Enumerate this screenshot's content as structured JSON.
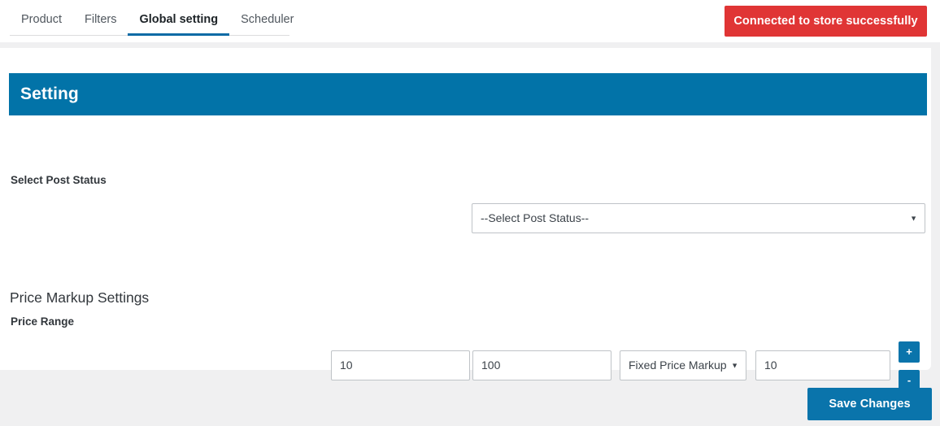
{
  "nav": {
    "tabs": [
      {
        "label": "Product",
        "active": false
      },
      {
        "label": "Filters",
        "active": false
      },
      {
        "label": "Global setting",
        "active": true
      },
      {
        "label": "Scheduler",
        "active": false
      }
    ],
    "status_banner": {
      "text": "Connected to store successfully",
      "color": "#e03535",
      "text_color": "#ffffff"
    }
  },
  "card": {
    "header": {
      "title": "Setting",
      "background": "#0273a8",
      "text_color": "#ffffff"
    },
    "post_status": {
      "label": "Select Post Status",
      "select_value": "--Select Post Status--",
      "caret": "chevron-down-icon"
    },
    "price_markup": {
      "section_heading": "Price Markup Settings",
      "label": "Price Range",
      "min_value": "10",
      "max_value": "100",
      "markup_type": "Fixed Price Markup",
      "markup_amount": "10",
      "add_button_label": "+",
      "remove_button_label": "-",
      "button_color": "#0a74ab"
    }
  },
  "footer": {
    "save_label": "Save Changes",
    "save_color": "#0a74ab"
  }
}
